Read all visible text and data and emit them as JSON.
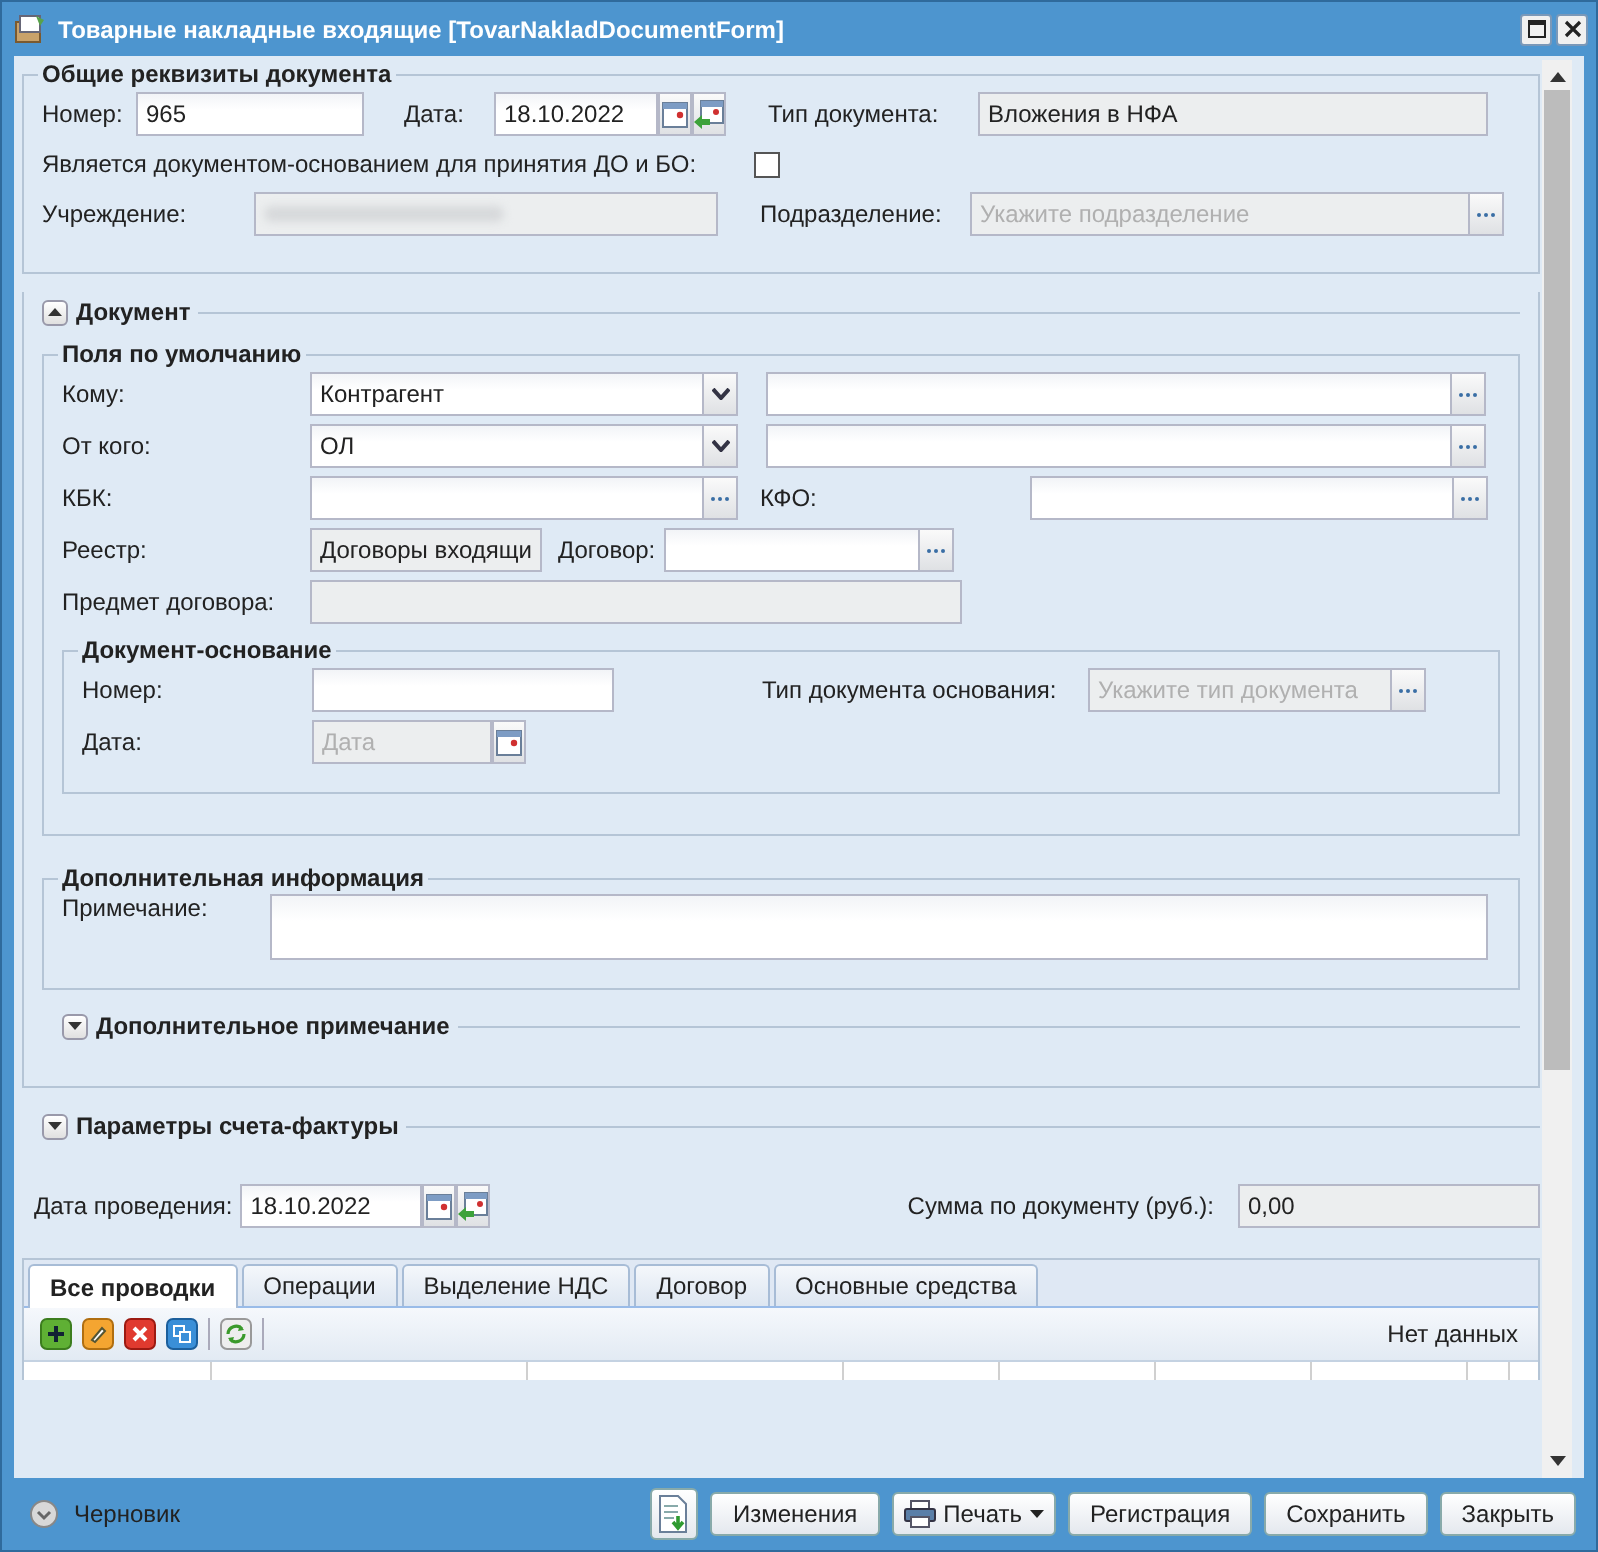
{
  "window": {
    "title": "Товарные накладные входящие [TovarNakladDocumentForm]",
    "status": "Черновик"
  },
  "general": {
    "title": "Общие реквизиты документа",
    "number": {
      "label": "Номер:",
      "value": "965"
    },
    "date": {
      "label": "Дата:",
      "value": "18.10.2022"
    },
    "doc_type": {
      "label": "Тип документа:",
      "value": "Вложения в НФА"
    },
    "is_basis": {
      "label": "Является документом-основанием для принятия ДО и БО:",
      "checked": false
    },
    "institution": {
      "label": "Учреждение:"
    },
    "subdivision": {
      "label": "Подразделение:",
      "placeholder": "Укажите подразделение"
    }
  },
  "document": {
    "title": "Документ",
    "expanded": true,
    "defaults": {
      "title": "Поля по умолчанию",
      "to": {
        "label": "Кому:",
        "value": "Контрагент"
      },
      "from": {
        "label": "От кого:",
        "value": "ОЛ"
      },
      "kbk": {
        "label": "КБК:"
      },
      "kfo": {
        "label": "КФО:"
      },
      "registry": {
        "label": "Реестр:",
        "value": "Договоры входящи"
      },
      "contract": {
        "label": "Договор:"
      },
      "subject": {
        "label": "Предмет договора:"
      }
    },
    "basis": {
      "title": "Документ-основание",
      "number": {
        "label": "Номер:"
      },
      "type": {
        "label": "Тип документа основания:",
        "placeholder": "Укажите тип документа"
      },
      "date": {
        "label": "Дата:",
        "placeholder": "Дата"
      }
    },
    "additional": {
      "title": "Дополнительная информация",
      "note": {
        "label": "Примечание:"
      }
    },
    "extra_note": {
      "title": "Дополнительное примечание",
      "expanded": false
    }
  },
  "invoice": {
    "title": "Параметры счета-фактуры",
    "expanded": false
  },
  "posting_date": {
    "label": "Дата проведения:",
    "value": "18.10.2022"
  },
  "total": {
    "label": "Сумма по документу (руб.):",
    "value": "0,00"
  },
  "tabs": [
    {
      "label": "Все проводки",
      "selected": true
    },
    {
      "label": "Операции",
      "selected": false
    },
    {
      "label": "Выделение НДС",
      "selected": false
    },
    {
      "label": "Договор",
      "selected": false
    },
    {
      "label": "Основные средства",
      "selected": false
    }
  ],
  "grid": {
    "status": "Нет данных"
  },
  "buttons": [
    {
      "label": "Изменения",
      "kind": "plain"
    },
    {
      "label": "Печать",
      "kind": "menu"
    },
    {
      "label": "Регистрация",
      "kind": "plain"
    },
    {
      "label": "Сохранить",
      "kind": "plain"
    },
    {
      "label": "Закрыть",
      "kind": "plain"
    }
  ]
}
